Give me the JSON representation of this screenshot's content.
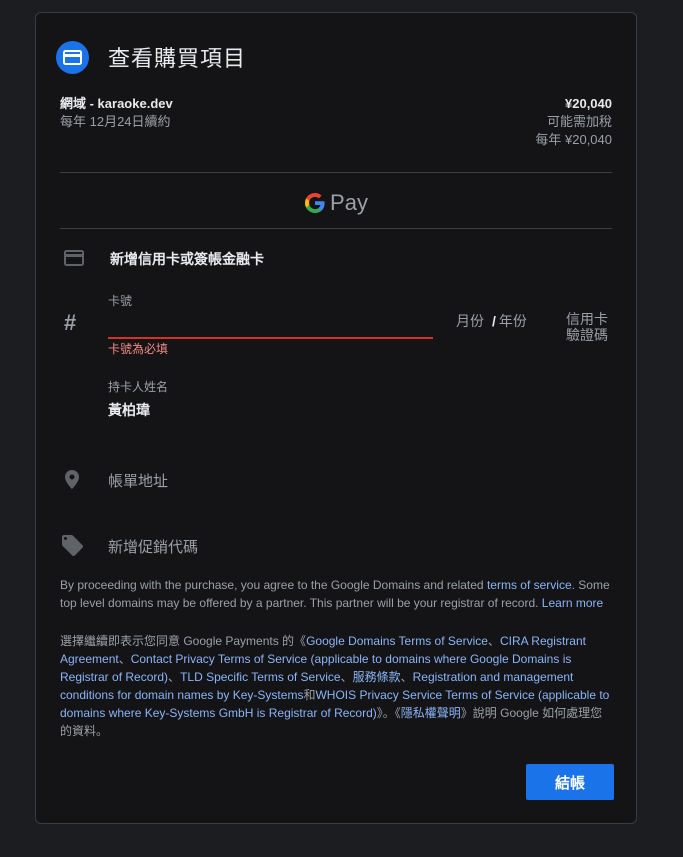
{
  "header": {
    "title": "查看購買項目",
    "icon": "credit-card-icon"
  },
  "order": {
    "domain": "網域 - karaoke.dev",
    "renewal": "每年 12月24日續約",
    "price": "¥20,040",
    "tax_note": "可能需加稅",
    "annual_price": "每年 ¥20,040"
  },
  "gpay": {
    "pay_text": "Pay"
  },
  "payment": {
    "add_card_label": "新增信用卡或簽帳金融卡",
    "card_number_label": "卡號",
    "card_number_value": "",
    "card_number_error": "卡號為必填",
    "expiry_month": "月份",
    "expiry_separator": "/",
    "expiry_year": "年份",
    "cvc_line1": "信用卡",
    "cvc_line2": "驗證碼",
    "holder_label": "持卡人姓名",
    "holder_value": "黃柏瑋",
    "billing_address": "帳單地址",
    "promo_code": "新增促銷代碼"
  },
  "legal_en": {
    "prefix": "By proceeding with the purchase, you agree to the Google Domains and related ",
    "terms_link": "terms of service",
    "middle": ". Some top level domains may be offered by a partner. This partner will be your registrar of record. ",
    "learn_more": "Learn more"
  },
  "legal_zh": {
    "prefix": "選擇繼續即表示您同意 Google Payments 的《",
    "link1": "Google Domains Terms of Service",
    "sep1": "、",
    "link2": "CIRA Registrant Agreement",
    "sep2": "、",
    "link3": "Contact Privacy Terms of Service (applicable to domains where Google Domains is Registrar of Record)",
    "sep3": "、",
    "link4": "TLD Specific Terms of Service",
    "sep4": "、",
    "link5": "服務條款",
    "sep5": "、",
    "link6": "Registration and management conditions for domain names by Key-Systems",
    "sep6": "和",
    "link7": "WHOIS Privacy Service Terms of Service (applicable to domains where Key-Systems GmbH is Registrar of Record)",
    "mid": "》。《",
    "link8": "隱私權聲明",
    "suffix": "》說明 Google 如何處理您的資料。"
  },
  "checkout_button": "結帳",
  "colors": {
    "accent": "#1a73e8",
    "error": "#d93025",
    "link": "#8ab4f8",
    "background": "#141416"
  }
}
